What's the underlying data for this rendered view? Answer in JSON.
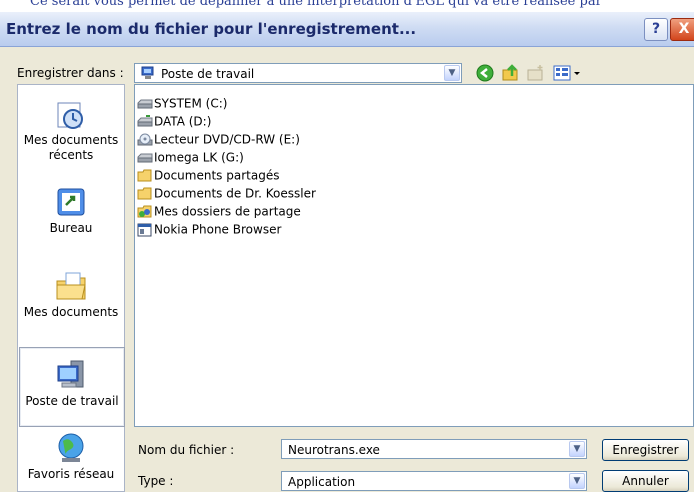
{
  "background_text": "Ce serait vous permet de dépanner à une interprétation d'EGL qui va être réalisée par",
  "dialog": {
    "title": "Entrez le nom du fichier pour l'enregistrement...",
    "help_button": "?",
    "close_button": "X"
  },
  "location": {
    "label": "Enregistrer dans :",
    "value": "Poste de travail"
  },
  "places": [
    {
      "label": "Mes documents récents",
      "icon": "recent-documents-icon"
    },
    {
      "label": "Bureau",
      "icon": "desktop-icon"
    },
    {
      "label": "Mes documents",
      "icon": "my-documents-icon"
    },
    {
      "label": "Poste de travail",
      "icon": "my-computer-icon"
    },
    {
      "label": "Favoris réseau",
      "icon": "network-places-icon"
    }
  ],
  "files": [
    {
      "name": "SYSTEM (C:)",
      "icon": "hard-drive-icon"
    },
    {
      "name": "DATA (D:)",
      "icon": "hard-drive-icon"
    },
    {
      "name": "Lecteur DVD/CD-RW (E:)",
      "icon": "dvd-drive-icon"
    },
    {
      "name": "Iomega LK (G:)",
      "icon": "hard-drive-icon"
    },
    {
      "name": "Documents partagés",
      "icon": "folder-icon"
    },
    {
      "name": "Documents de Dr. Koessler",
      "icon": "folder-icon"
    },
    {
      "name": "Mes dossiers de partage",
      "icon": "shared-folder-icon"
    },
    {
      "name": "Nokia Phone Browser",
      "icon": "phone-browser-icon"
    }
  ],
  "filename": {
    "label": "Nom du fichier :",
    "value": "Neurotrans.exe"
  },
  "filetype": {
    "label": "Type :",
    "value": "Application"
  },
  "buttons": {
    "save": "Enregistrer",
    "cancel": "Annuler"
  }
}
